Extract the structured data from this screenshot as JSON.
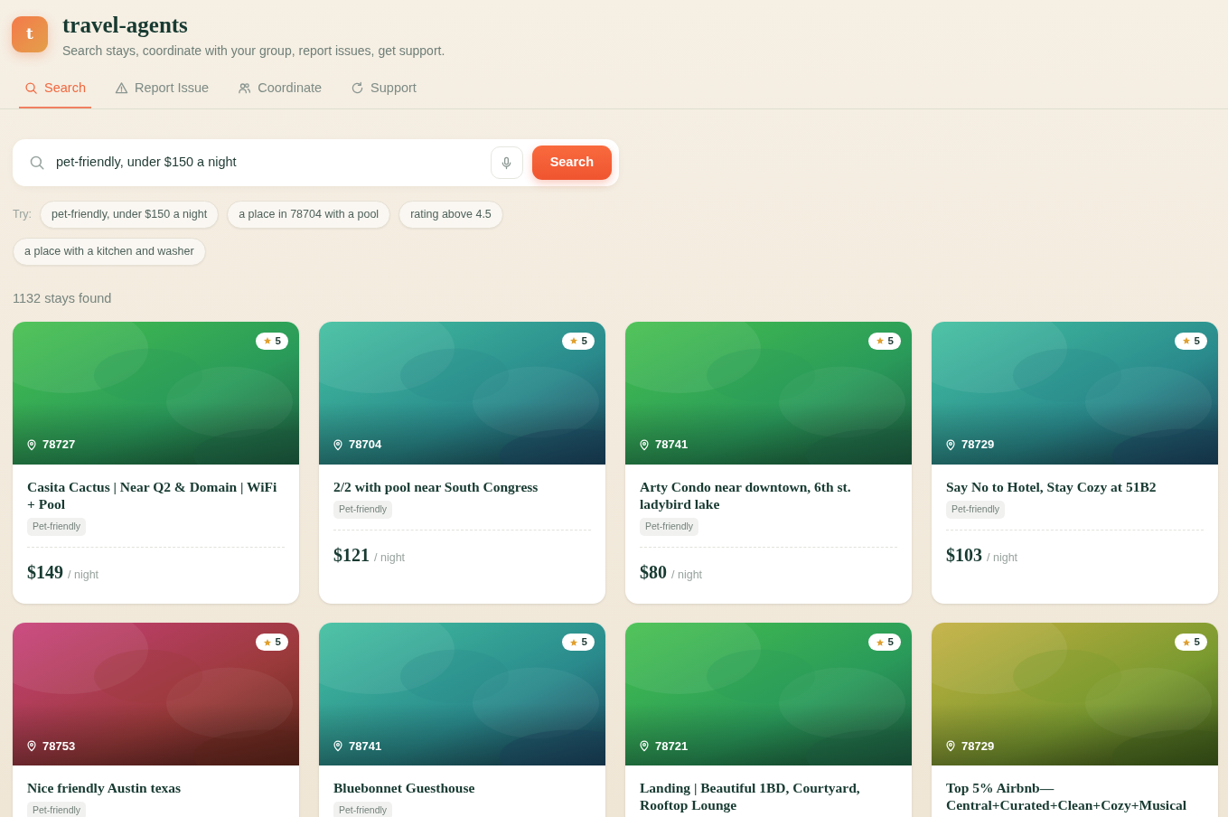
{
  "app": {
    "logo_letter": "t",
    "title": "travel-agents",
    "subtitle": "Search stays, coordinate with your group, report issues, get support."
  },
  "tabs": [
    {
      "label": "Search",
      "kind": "search",
      "selected": true
    },
    {
      "label": "Report Issue",
      "kind": "warning",
      "selected": false
    },
    {
      "label": "Coordinate",
      "kind": "people",
      "selected": false
    },
    {
      "label": "Support",
      "kind": "refresh",
      "selected": false
    }
  ],
  "search": {
    "value": "pet-friendly, under $150 a night",
    "button": "Search"
  },
  "suggestions": {
    "label": "Try:",
    "items": [
      "pet-friendly, under $150 a night",
      "a place in 78704 with a pool",
      "rating above 4.5",
      "a place with a kitchen and washer"
    ]
  },
  "result_count": "1132 stays found",
  "listings": [
    {
      "rating": "5",
      "zip": "78727",
      "title": "Casita Cactus | Near Q2 & Domain | WiFi + Pool",
      "tag": "Pet-friendly",
      "price": "$149",
      "unit": "/ night"
    },
    {
      "rating": "5",
      "zip": "78704",
      "title": "2/2 with pool near South Congress",
      "tag": "Pet-friendly",
      "price": "$121",
      "unit": "/ night"
    },
    {
      "rating": "5",
      "zip": "78741",
      "title": "Arty Condo near downtown, 6th st. ladybird lake",
      "tag": "Pet-friendly",
      "price": "$80",
      "unit": "/ night"
    },
    {
      "rating": "5",
      "zip": "78729",
      "title": "Say No to Hotel, Stay Cozy at 51B2",
      "tag": "Pet-friendly",
      "price": "$103",
      "unit": "/ night"
    },
    {
      "rating": "5",
      "zip": "78753",
      "title": "Nice friendly Austin texas",
      "tag": "Pet-friendly"
    },
    {
      "rating": "5",
      "zip": "78741",
      "title": "Bluebonnet Guesthouse",
      "tag": "Pet-friendly"
    },
    {
      "rating": "5",
      "zip": "78721",
      "title": "Landing | Beautiful 1BD, Courtyard, Rooftop Lounge"
    },
    {
      "rating": "5",
      "zip": "78729",
      "title": "Top 5% Airbnb—Central+Curated+Clean+Cozy+Musical"
    }
  ]
}
